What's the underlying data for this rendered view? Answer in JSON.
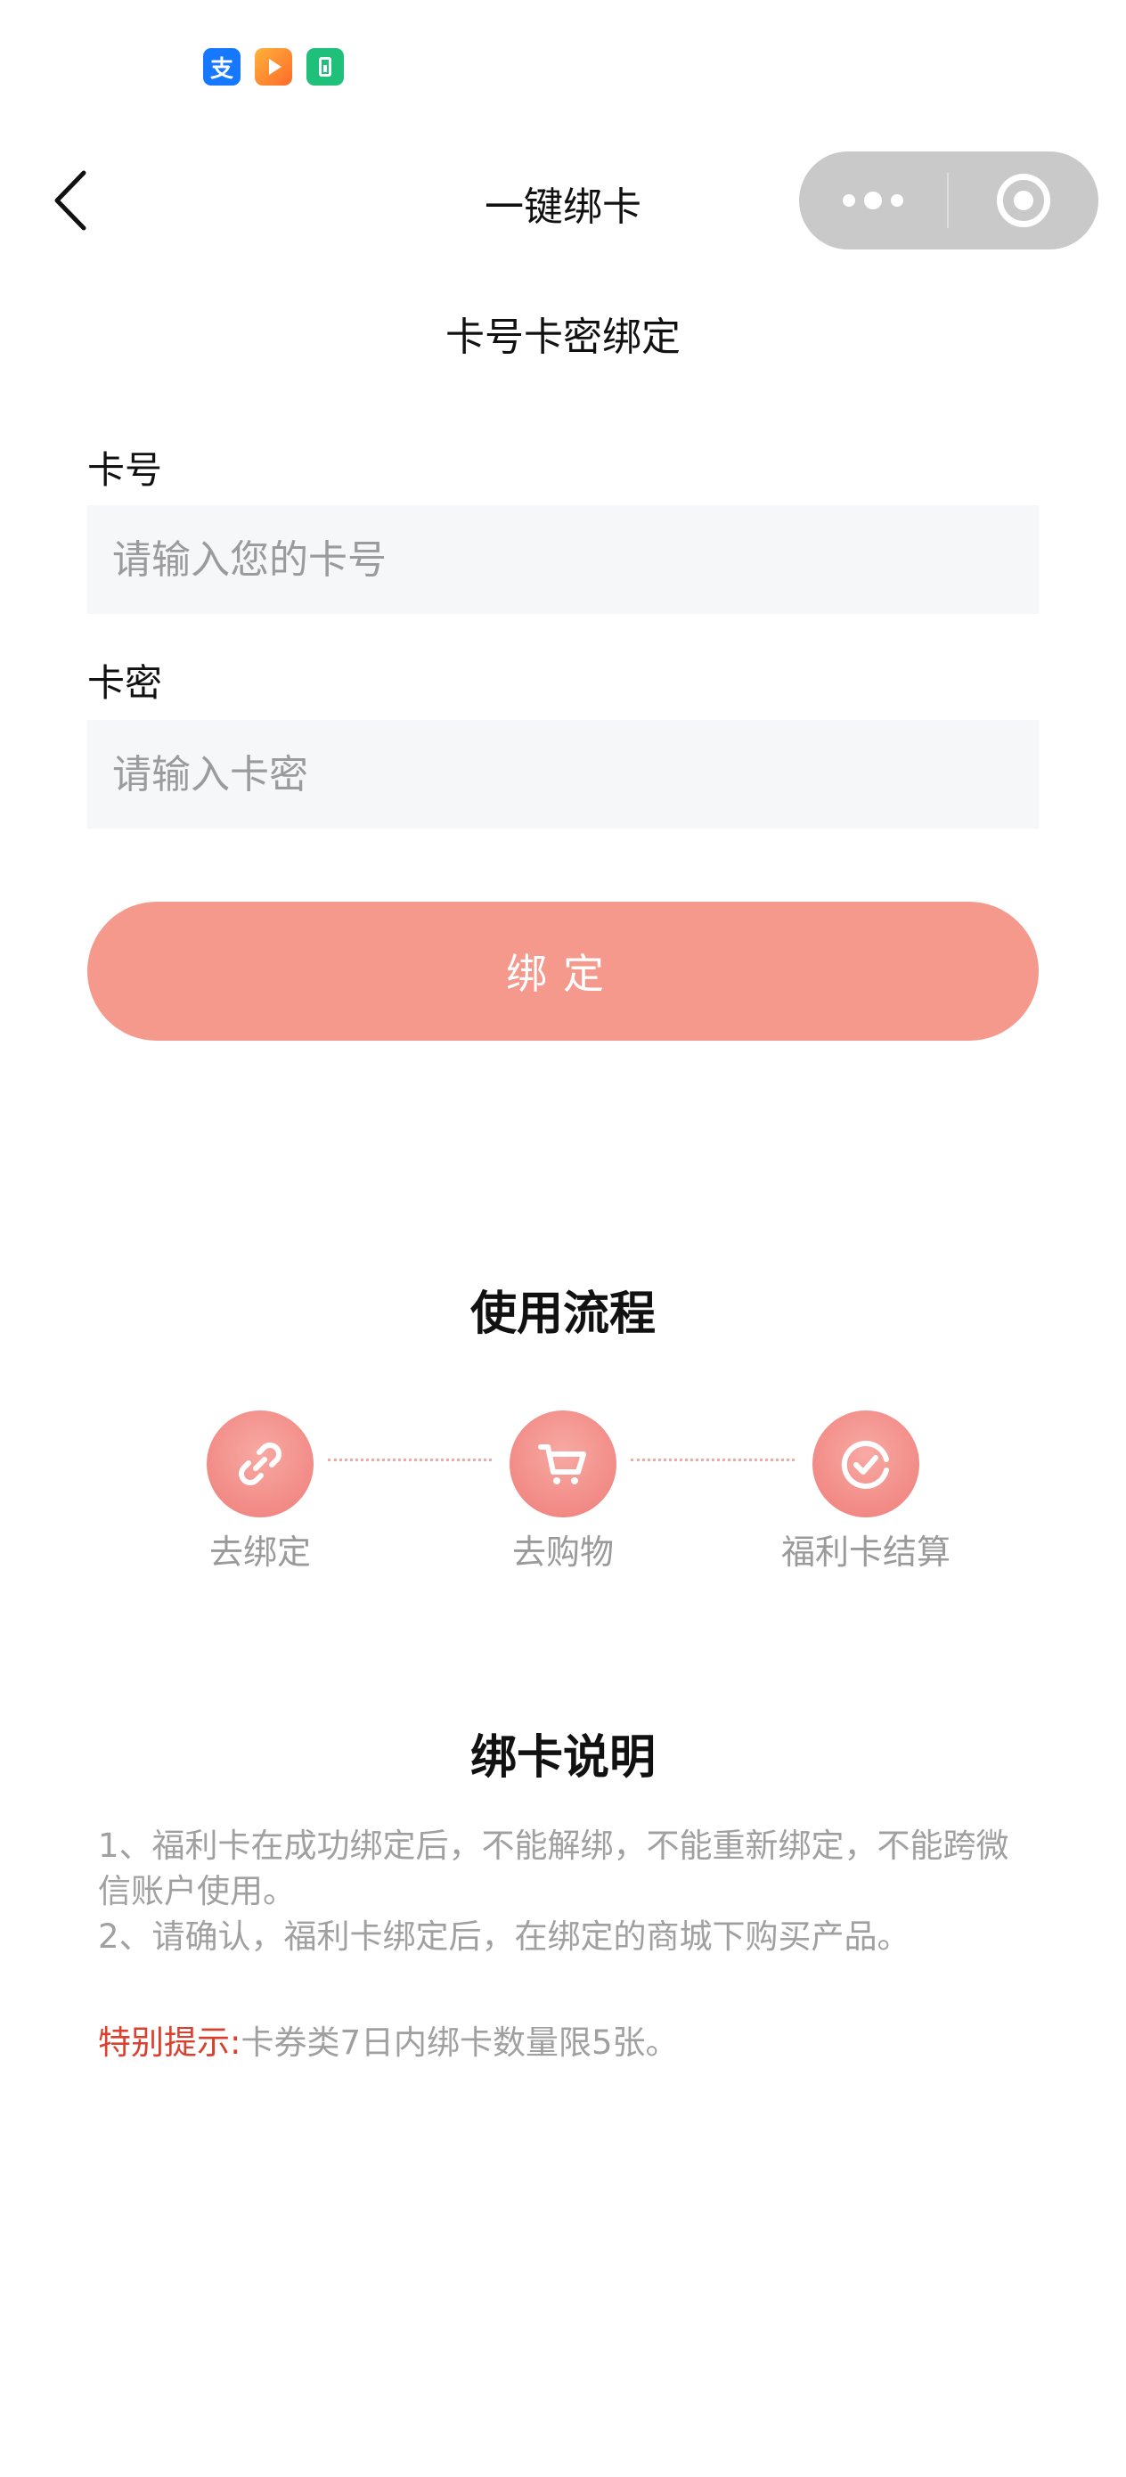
{
  "status_bar": {
    "icons": [
      "alipay-icon",
      "video-app-icon",
      "battery-app-icon"
    ],
    "alipay_glyph": "支"
  },
  "nav": {
    "title": "一键绑卡",
    "back_icon": "chevron-left-icon",
    "capsule": {
      "more_icon": "more-dots-icon",
      "close_icon": "target-circle-icon"
    }
  },
  "form": {
    "section_title": "卡号卡密绑定",
    "card_number_label": "卡号",
    "card_number_placeholder": "请输入您的卡号",
    "card_number_value": "",
    "card_secret_label": "卡密",
    "card_secret_placeholder": "请输入卡密",
    "card_secret_value": "",
    "bind_button_label": "绑定"
  },
  "process": {
    "title": "使用流程",
    "steps": [
      {
        "label": "去绑定",
        "icon": "link-icon"
      },
      {
        "label": "去购物",
        "icon": "shopping-cart-icon"
      },
      {
        "label": "福利卡结算",
        "icon": "check-circle-icon"
      }
    ]
  },
  "instructions": {
    "title": "绑卡说明",
    "items": [
      "1、福利卡在成功绑定后，不能解绑，不能重新绑定，不能跨微信账户使用。",
      "2、请确认，福利卡绑定后，在绑定的商城下购买产品。"
    ],
    "tip_prefix": "特别提示:",
    "tip_text": "卡券类7日内绑卡数量限5张。"
  },
  "colors": {
    "accent": "#f4998c",
    "step_circle": "#f08a85",
    "tip_red": "#d8412f",
    "muted_text": "#a0a0a0",
    "input_bg": "#f6f7f9"
  }
}
